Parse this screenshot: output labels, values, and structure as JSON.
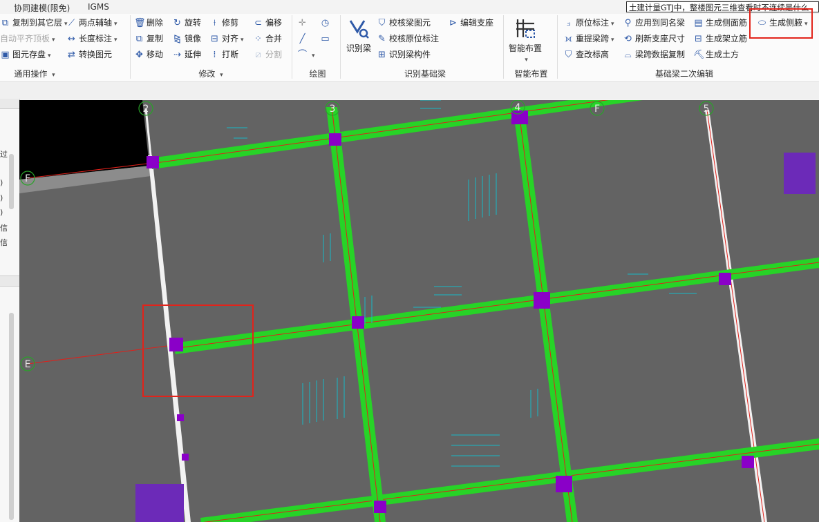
{
  "menu": {
    "items": [
      "协同建模(限免)",
      "IGMS"
    ]
  },
  "notice": "土建计量GTJ中，整楼图元三维查看时不连续是什么",
  "ribbon": {
    "general": {
      "copy_to_layer": "复制到其它层",
      "auto_align_top": "自动平齐顶板",
      "save_element": "图元存盘",
      "label": "通用操作"
    },
    "aux": {
      "two_point_axis": "两点辅轴",
      "length_mark": "长度标注",
      "convert_element": "转换图元"
    },
    "modify": {
      "delete": "删除",
      "rotate": "旋转",
      "trim": "修剪",
      "offset": "偏移",
      "copy": "复制",
      "mirror": "镜像",
      "align": "对齐",
      "merge": "合并",
      "move": "移动",
      "extend": "延伸",
      "break": "打断",
      "split": "分割",
      "label": "修改"
    },
    "draw": {
      "label": "绘图"
    },
    "recognize": {
      "identify_beam": "识别梁",
      "check_beam": "校核梁图元",
      "check_orig_mark": "校核原位标注",
      "identify_beam_member": "识别梁构件",
      "edit_support": "编辑支座",
      "label": "识别基础梁"
    },
    "smart": {
      "smart_layout": "智能布置",
      "label": "智能布置"
    },
    "secondary": {
      "orig_mark": "原位标注",
      "apply_same_name": "应用到同名梁",
      "gen_side_rebar": "生成侧面筋",
      "gen_haunch": "生成侧腋",
      "re_span": "重提梁跨",
      "refresh_support": "刷新支座尺寸",
      "gen_frame_rebar": "生成架立筋",
      "check_elev": "查改标高",
      "copy_span_data": "梁跨数据复制",
      "gen_earthwork": "生成土方",
      "label": "基础梁二次编辑"
    }
  },
  "left_panel": [
    "过",
    ")",
    ")",
    ")",
    "信",
    "信"
  ],
  "axes": {
    "a2": "2",
    "a3": "3",
    "a4": "4",
    "a5": "5",
    "aF1": "F",
    "aF2": "F",
    "aE": "E"
  },
  "colors": {
    "beam": "#27d327",
    "column": "#8a00c8",
    "canvas": "#636363",
    "axis": "#e0201a",
    "highlight": "#e2231a"
  }
}
